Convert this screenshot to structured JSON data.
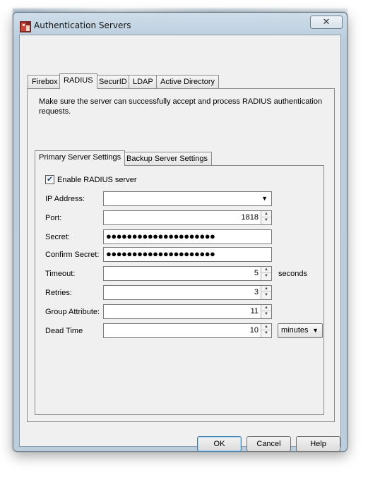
{
  "window": {
    "title": "Authentication Servers",
    "close_glyph": "✕"
  },
  "tabs": [
    {
      "label": "Firebox",
      "active": false
    },
    {
      "label": "RADIUS",
      "active": true
    },
    {
      "label": "SecurID",
      "active": false
    },
    {
      "label": "LDAP",
      "active": false
    },
    {
      "label": "Active Directory",
      "active": false
    }
  ],
  "description": "Make sure the server can successfully accept and process RADIUS authentication requests.",
  "inner_tabs": [
    {
      "label": "Primary Server Settings",
      "active": true
    },
    {
      "label": "Backup Server Settings",
      "active": false
    }
  ],
  "enable": {
    "label": "Enable RADIUS server",
    "checked": true,
    "check_glyph": "✔"
  },
  "fields": {
    "ip_address": {
      "label": "IP Address:",
      "value": ""
    },
    "port": {
      "label": "Port:",
      "value": "1818"
    },
    "secret": {
      "label": "Secret:",
      "value": "●●●●●●●●●●●●●●●●●●●●●"
    },
    "confirm_secret": {
      "label": "Confirm Secret:",
      "value": "●●●●●●●●●●●●●●●●●●●●●"
    },
    "timeout": {
      "label": "Timeout:",
      "value": "5",
      "unit": "seconds"
    },
    "retries": {
      "label": "Retries:",
      "value": "3"
    },
    "group_attribute": {
      "label": "Group Attribute:",
      "value": "11"
    },
    "dead_time": {
      "label": "Dead Time",
      "value": "10",
      "unit": "minutes"
    }
  },
  "buttons": {
    "ok": "OK",
    "cancel": "Cancel",
    "help": "Help"
  },
  "icons": {
    "app": "watchguard-app-icon",
    "spin_up": "▲",
    "spin_down": "▼",
    "dropdown": "▼"
  }
}
